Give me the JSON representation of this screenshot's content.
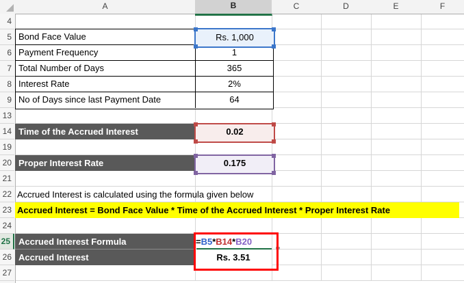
{
  "colors": {
    "selection_blue": "#3b76ca",
    "reference_red": "#bf4a47",
    "reference_purple": "#8064a2",
    "excel_green": "#217346",
    "label_gray": "#595959",
    "highlight_yellow": "#ffff00",
    "result_box_red": "#fe0000"
  },
  "col_headers": [
    "A",
    "B",
    "C",
    "D",
    "E",
    "F"
  ],
  "selected_column": "B",
  "row_numbers": [
    "4",
    "5",
    "6",
    "7",
    "8",
    "9",
    "13",
    "14",
    "19",
    "20",
    "21",
    "22",
    "23",
    "24",
    "25",
    "26",
    "27"
  ],
  "active_row": "25",
  "input_table": {
    "rows": [
      {
        "label": "Bond Face Value",
        "value": "Rs. 1,000"
      },
      {
        "label": "Payment Frequency",
        "value": "1"
      },
      {
        "label": "Total Number of Days",
        "value": "365"
      },
      {
        "label": "Interest Rate",
        "value": "2%"
      },
      {
        "label": "No of Days since last Payment Date",
        "value": "64"
      }
    ]
  },
  "time_accrued": {
    "label": "Time of the Accrued Interest",
    "value": "0.02"
  },
  "proper_rate": {
    "label": "Proper Interest Rate",
    "value": "0.175"
  },
  "note_text": "Accrued Interest is calculated using the formula given below",
  "formula_banner": "Accrued Interest = Bond Face Value * Time of the Accrued Interest * Proper Interest Rate",
  "formula_row": {
    "label": "Accrued Interest Formula",
    "formula": {
      "eq": "=",
      "ref1": "B5",
      "op1": "*",
      "ref2": "B14",
      "op2": "*",
      "ref3": "B20"
    }
  },
  "result_row": {
    "label": "Accrued Interest",
    "value": "Rs. 3.51"
  }
}
